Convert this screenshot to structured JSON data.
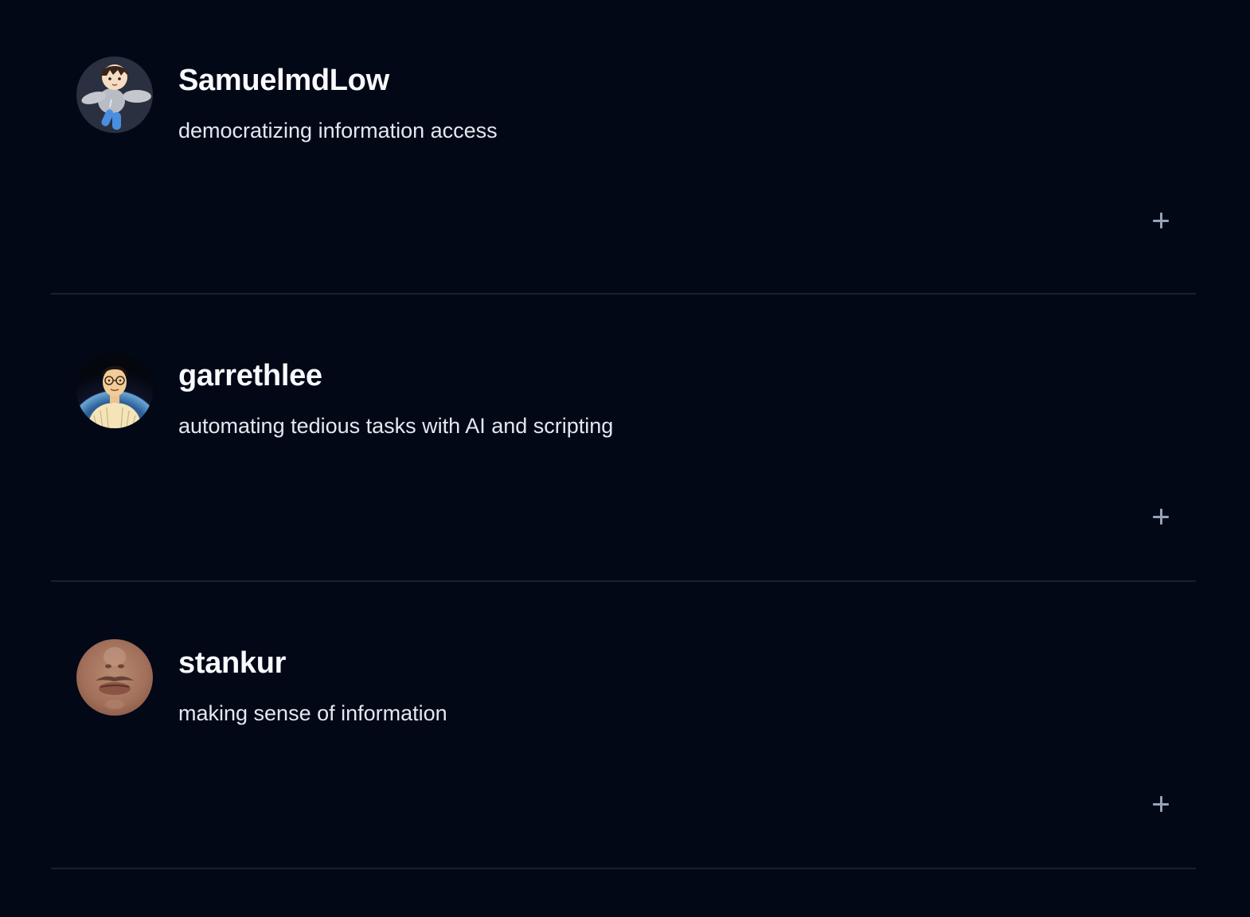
{
  "profiles": [
    {
      "username": "SamuelmdLow",
      "bio": "democratizing information access",
      "avatar_icon": "cartoon-character-avatar-icon"
    },
    {
      "username": "garrethlee",
      "bio": "automating tedious tasks with AI and scripting",
      "avatar_icon": "illustrated-person-with-glasses-avatar-icon"
    },
    {
      "username": "stankur",
      "bio": "making sense of information",
      "avatar_icon": "close-up-face-photo-avatar-icon"
    }
  ],
  "colors": {
    "background": "#030817",
    "divider": "#1a2030",
    "name_text": "#f8fafc",
    "bio_text": "#e2e8f0",
    "expand_icon": "#94a3b8"
  }
}
